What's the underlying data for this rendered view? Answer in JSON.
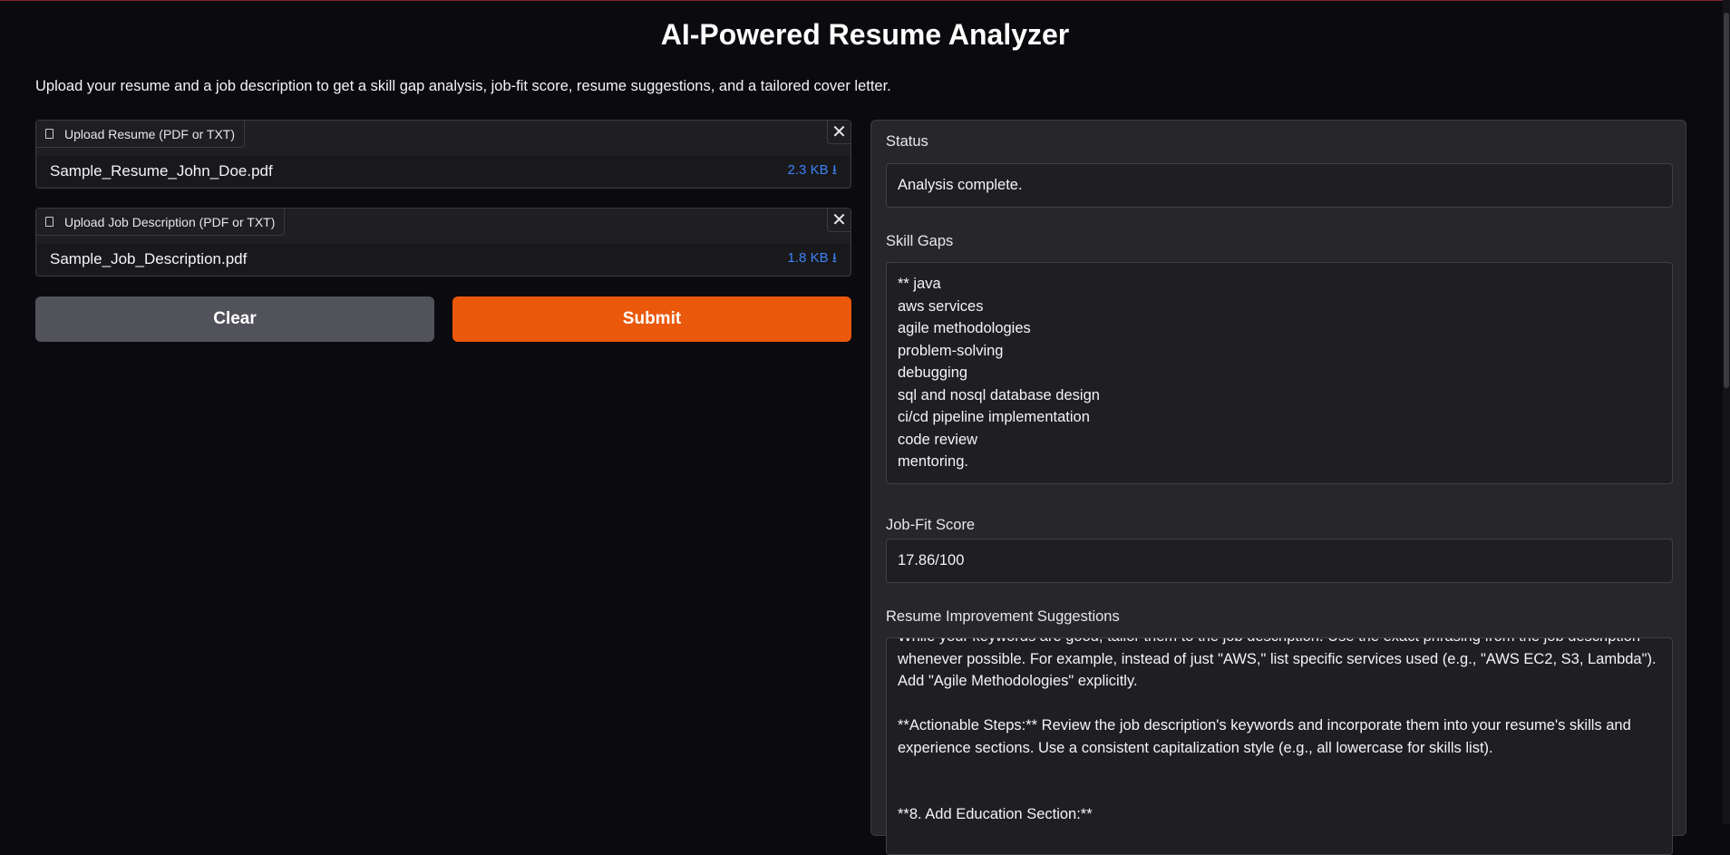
{
  "page": {
    "title": "AI-Powered Resume Analyzer",
    "intro": "Upload your resume and a job description to get a skill gap analysis, job-fit score, resume suggestions, and a tailored cover letter."
  },
  "resume_upload": {
    "label": "Upload Resume (PDF or TXT)",
    "file_name": "Sample_Resume_John_Doe.pdf",
    "file_size": "2.3 KB ⭳"
  },
  "jd_upload": {
    "label": "Upload Job Description (PDF or TXT)",
    "file_name": "Sample_Job_Description.pdf",
    "file_size": "1.8 KB ⭳"
  },
  "actions": {
    "clear_label": "Clear",
    "submit_label": "Submit"
  },
  "outputs": {
    "status_label": "Status",
    "status_value": "Analysis complete.",
    "skill_gaps_label": "Skill Gaps",
    "skill_gaps": [
      "** java",
      "aws services",
      "agile methodologies",
      "problem-solving",
      "debugging",
      "sql and nosql database design",
      "ci/cd pipeline implementation",
      "code review",
      "mentoring."
    ],
    "job_fit_label": "Job-Fit Score",
    "job_fit_value": "17.86/100",
    "suggestions_label": "Resume Improvement Suggestions",
    "suggestions_lines": [
      "While your keywords are good, tailor them to the job description.  Use the exact phrasing from the job description",
      "whenever possible.  For example, instead of just \"AWS,\" list specific services used (e.g., \"AWS EC2, S3, Lambda\").",
      "Add \"Agile Methodologies\" explicitly.",
      "",
      "**Actionable Steps:**  Review the job description's keywords and incorporate them into your resume's skills and",
      "experience sections.  Use a consistent capitalization style (e.g., all lowercase for skills list).",
      "",
      "",
      "**8.  Add Education Section:**"
    ]
  },
  "colors": {
    "background": "#0b0b0f",
    "panel": "#27272a",
    "primary": "#ea580c",
    "secondary": "#52525b",
    "link": "#3b82f6"
  }
}
